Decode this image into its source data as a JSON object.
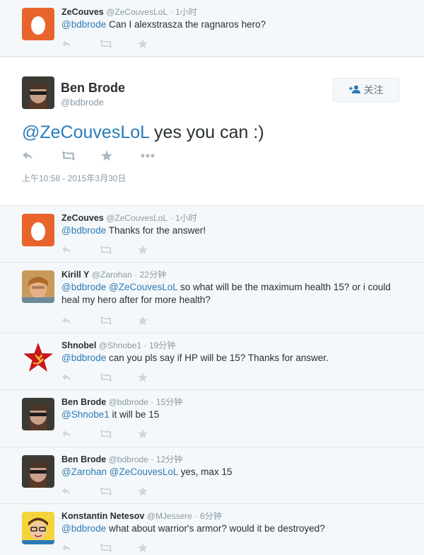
{
  "icons": [
    "reply-icon",
    "retweet-icon",
    "favorite-icon",
    "more-icon"
  ],
  "top_tweet": {
    "fullname": "ZeCouves",
    "handle": "@ZeCouvesLoL",
    "dot": "·",
    "time": "1小时",
    "mention": "@bdbrode",
    "text": " Can I alexstrasza the ragnaros hero?"
  },
  "main_tweet": {
    "fullname": "Ben Brode",
    "handle": "@bdbrode",
    "follow_label": "关注",
    "mention": "@ZeCouvesLoL",
    "text": " yes you can :)",
    "timestamp": "上午10:58 - 2015年3月30日"
  },
  "replies": [
    {
      "fullname": "ZeCouves",
      "handle": "@ZeCouvesLoL",
      "dot": "·",
      "time": "1小时",
      "mentions": [
        "@bdbrode"
      ],
      "text": " Thanks for the answer!"
    },
    {
      "fullname": "Kirill Y",
      "handle": "@Zarohan",
      "dot": "·",
      "time": "22分钟",
      "mentions": [
        "@bdbrode",
        "@ZeCouvesLoL"
      ],
      "text": " so what will be the maximum health 15? or i could heal my hero after for more health?"
    },
    {
      "fullname": "Shnobel",
      "handle": "@Shnobe1",
      "dot": "·",
      "time": "19分钟",
      "mentions": [
        "@bdbrode"
      ],
      "text": " can you pls say if HP will be 15? Thanks for answer."
    },
    {
      "fullname": "Ben Brode",
      "handle": "@bdbrode",
      "dot": "·",
      "time": "15分钟",
      "mentions": [
        "@Shnobe1"
      ],
      "text": " it will be 15"
    },
    {
      "fullname": "Ben Brode",
      "handle": "@bdbrode",
      "dot": "·",
      "time": "12分钟",
      "mentions": [
        "@Zarohan",
        "@ZeCouvesLoL"
      ],
      "text": " yes, max 15"
    },
    {
      "fullname": "Konstantin Netesov",
      "handle": "@MJessere",
      "dot": "·",
      "time": "6分钟",
      "mentions": [
        "@bdbrode"
      ],
      "text": " what about warrior's armor? would it be destroyed?"
    }
  ],
  "colors": {
    "link": "#2b7bb9",
    "muted": "#8899a6",
    "egg": "#e8642c",
    "bg": "#f5f8fa"
  }
}
